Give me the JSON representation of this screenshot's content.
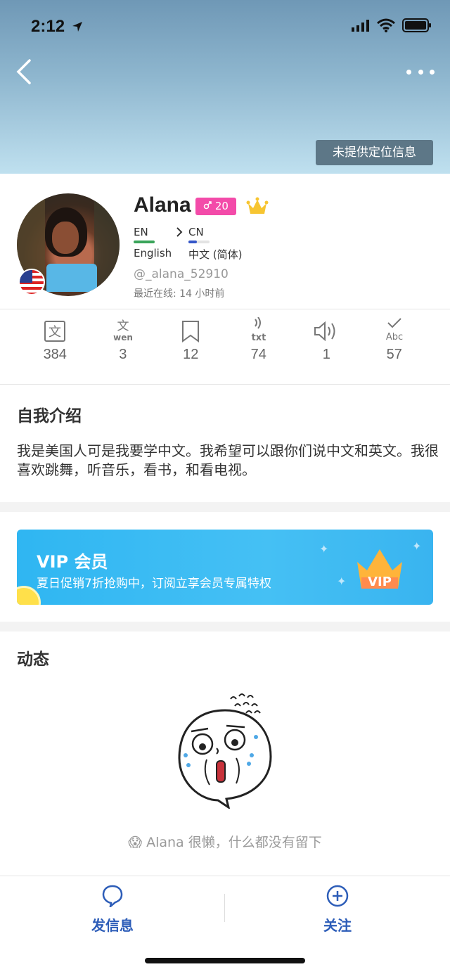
{
  "status_bar": {
    "time": "2:12",
    "icons": [
      "location-arrow-icon",
      "signal-icon",
      "wifi-icon",
      "battery-icon"
    ]
  },
  "header": {
    "location_badge": "未提供定位信息",
    "icons": [
      "back-icon",
      "more-icon"
    ]
  },
  "profile": {
    "name": "Alana",
    "level": "20",
    "native_code": "EN",
    "native_name": "English",
    "learning_code": "CN",
    "learning_name": "中文 (简体)",
    "handle": "@_alana_52910",
    "last_online": "最近在线: 14 小时前",
    "colors": {
      "native_bar": "#3aa45a",
      "learning_bar": "#3556c8",
      "level_badge": "#f34ba9",
      "crown": "#f7c531"
    }
  },
  "stats": [
    {
      "icon": "wen-character-icon",
      "value": "384"
    },
    {
      "icon": "wen-pinyin-icon",
      "value": "3"
    },
    {
      "icon": "bookmark-icon",
      "value": "12"
    },
    {
      "icon": "voice-text-icon",
      "value": "74"
    },
    {
      "icon": "speaker-icon",
      "value": "1"
    },
    {
      "icon": "check-abc-icon",
      "value": "57"
    }
  ],
  "intro": {
    "title": "自我介绍",
    "text": "我是美国人可是我要学中文。我希望可以跟你们说中文和英文。我很喜欢跳舞，听音乐，看书，和看电视。"
  },
  "vip": {
    "title": "VIP 会员",
    "subtitle": "夏日促销7折抢购中，订阅立享会员专属特权",
    "badge": "VIP",
    "colors": {
      "background": "#36b8f2"
    }
  },
  "feed": {
    "title": "动态",
    "empty_message": "Alana 很懒，什么都没有留下"
  },
  "bottom_bar": {
    "message_label": "发信息",
    "follow_label": "关注",
    "colors": {
      "accent": "#2d5db8"
    }
  }
}
